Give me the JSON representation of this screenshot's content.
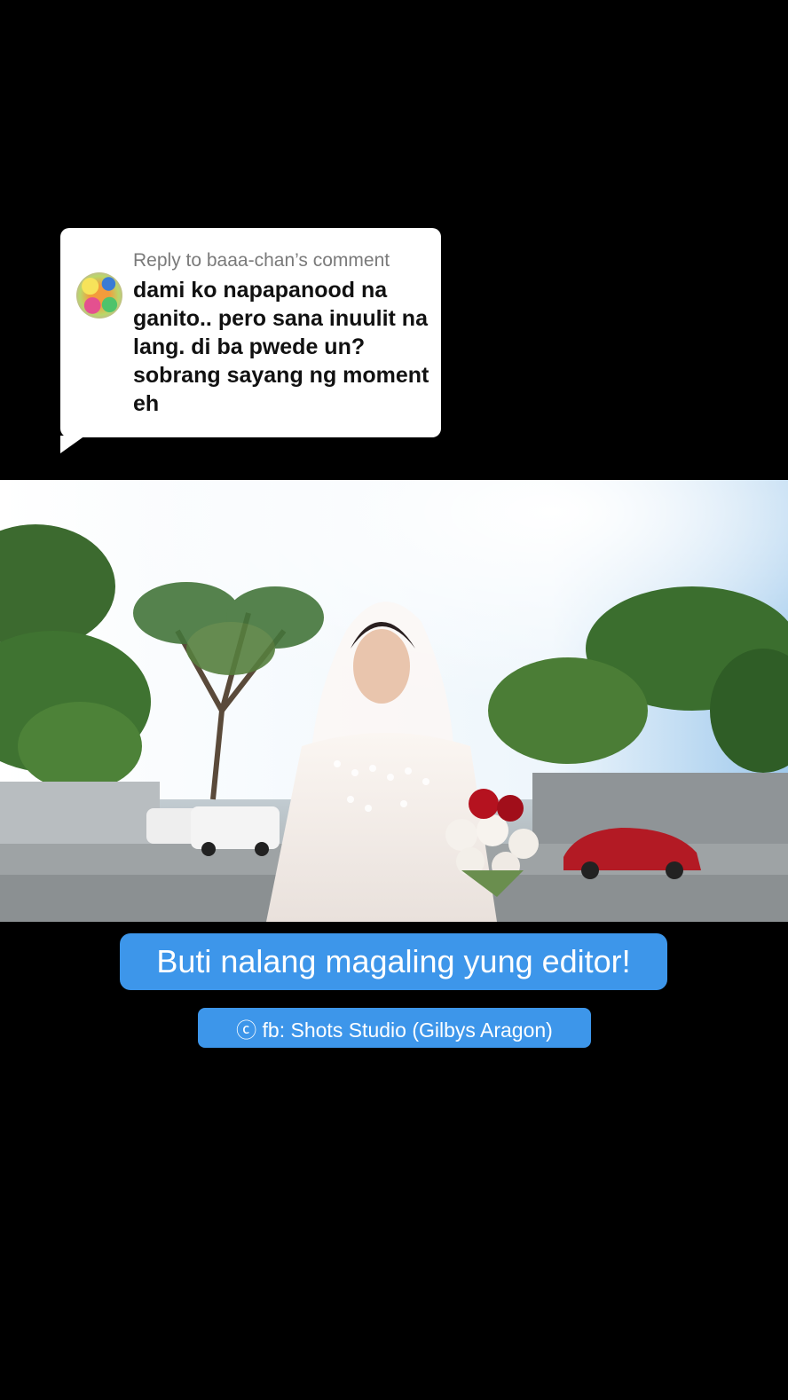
{
  "reply": {
    "header": "Reply to baaa-chan’s comment",
    "comment": "dami ko napapanood na ganito.. pero sana inuulit na lang. di ba pwede un? sobrang sayang ng moment eh"
  },
  "video": {
    "scene": "bride-with-bouquet"
  },
  "caption": {
    "text": "Buti nalang magaling yung editor!"
  },
  "credit": {
    "text": "ⓒ fb: Shots Studio (Gilbys Aragon)"
  },
  "colors": {
    "background": "#000000",
    "caption_pill": "#3d96ea",
    "bubble": "#ffffff",
    "reply_header": "#7a7a7a"
  }
}
